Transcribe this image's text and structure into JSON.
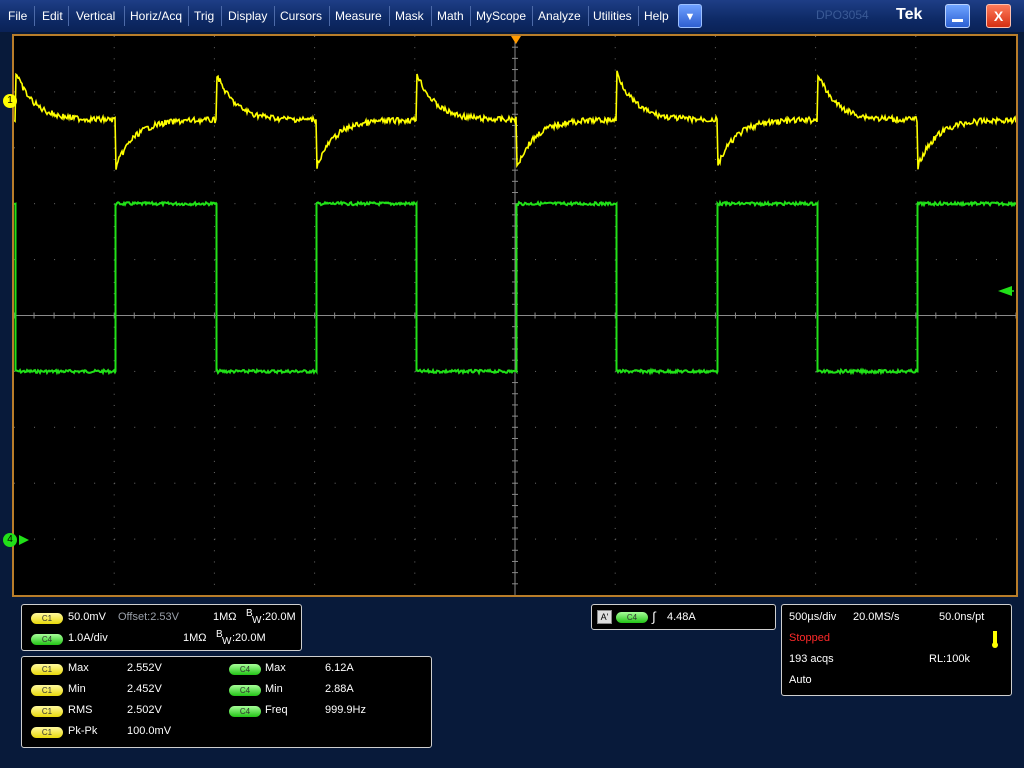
{
  "menu": {
    "items": [
      "File",
      "Edit",
      "Vertical",
      "Horiz/Acq",
      "Trig",
      "Display",
      "Cursors",
      "Measure",
      "Mask",
      "Math",
      "MyScope",
      "Analyze",
      "Utilities",
      "Help"
    ],
    "dropdown_glyph": "▼",
    "model": "DPO3054",
    "brand": "Tek",
    "close_glyph": "X"
  },
  "colors": {
    "ch1": "#ffff00",
    "ch4": "#21e018",
    "graticule_border": "#b87d2a",
    "trigger_marker": "#ff9a00"
  },
  "waveforms": {
    "time_per_div_us": 500,
    "period_us": 1000,
    "ch4_high_div": 2.0,
    "ch4_low_div": -1.0,
    "ch1_baseline_div": 3.5,
    "ch1_spike_div": 0.85
  },
  "channel_markers": {
    "ch1": "1",
    "ch4": "4"
  },
  "channel_settings": {
    "ch1": {
      "badge": "C1",
      "scale": "50.0mV",
      "offset": "Offset:2.53V",
      "impedance": "1MΩ",
      "bw_b": "B",
      "bw_w": "W",
      "bw_value": ":20.0M"
    },
    "ch4": {
      "badge": "C4",
      "scale": "1.0A/div",
      "impedance": "1MΩ",
      "bw_b": "B",
      "bw_w": "W",
      "bw_value": ":20.0M"
    }
  },
  "measurements": {
    "left": [
      {
        "badge": "C1",
        "label": "Max",
        "value": "2.552V"
      },
      {
        "badge": "C1",
        "label": "Min",
        "value": "2.452V"
      },
      {
        "badge": "C1",
        "label": "RMS",
        "value": "2.502V"
      },
      {
        "badge": "C1",
        "label": "Pk-Pk",
        "value": "100.0mV"
      }
    ],
    "right": [
      {
        "badge": "C4",
        "label": "Max",
        "value": "6.12A"
      },
      {
        "badge": "C4",
        "label": "Min",
        "value": "2.88A"
      },
      {
        "badge": "C4",
        "label": "Freq",
        "value": "999.9Hz"
      }
    ]
  },
  "trigger": {
    "mode_badge": "A'",
    "source_badge": "C4",
    "slope_glyph": "∫",
    "level": "4.48A"
  },
  "acquisition": {
    "time_div": "500µs/div",
    "sample_rate": "20.0MS/s",
    "resolution": "50.0ns/pt",
    "state": "Stopped",
    "acqs": "193 acqs",
    "record_length": "RL:100k",
    "mode": "Auto"
  }
}
